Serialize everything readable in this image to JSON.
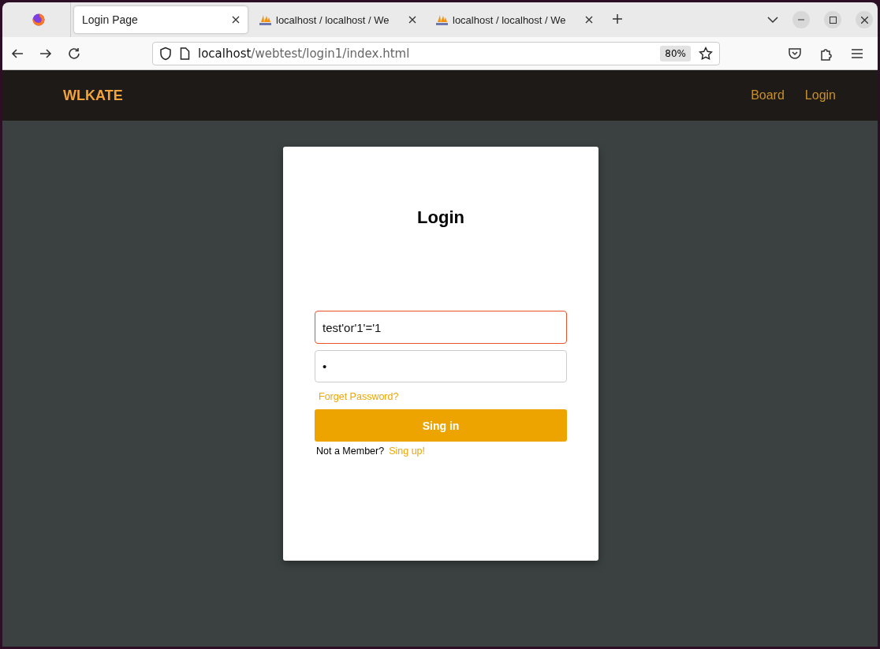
{
  "browser": {
    "tabs": [
      {
        "title": "Login Page",
        "selected": true,
        "kind": "page"
      },
      {
        "title": "localhost / localhost / We",
        "selected": false,
        "kind": "pma"
      },
      {
        "title": "localhost / localhost / We",
        "selected": false,
        "kind": "pma"
      }
    ],
    "address": {
      "host": "localhost",
      "path": "/webtest/login1/index.html"
    },
    "zoom": "80%"
  },
  "navbar": {
    "brand": "WLKATE",
    "links": [
      "Board",
      "Login"
    ]
  },
  "login": {
    "title": "Login",
    "fields": [
      {
        "value": "test'or'1'='1",
        "focused": true
      },
      {
        "value": "•",
        "focused": false
      }
    ],
    "forgot": "Forget Password?",
    "button": "Sing in",
    "prompt": "Not a Member?",
    "signup": "Sing up!"
  }
}
